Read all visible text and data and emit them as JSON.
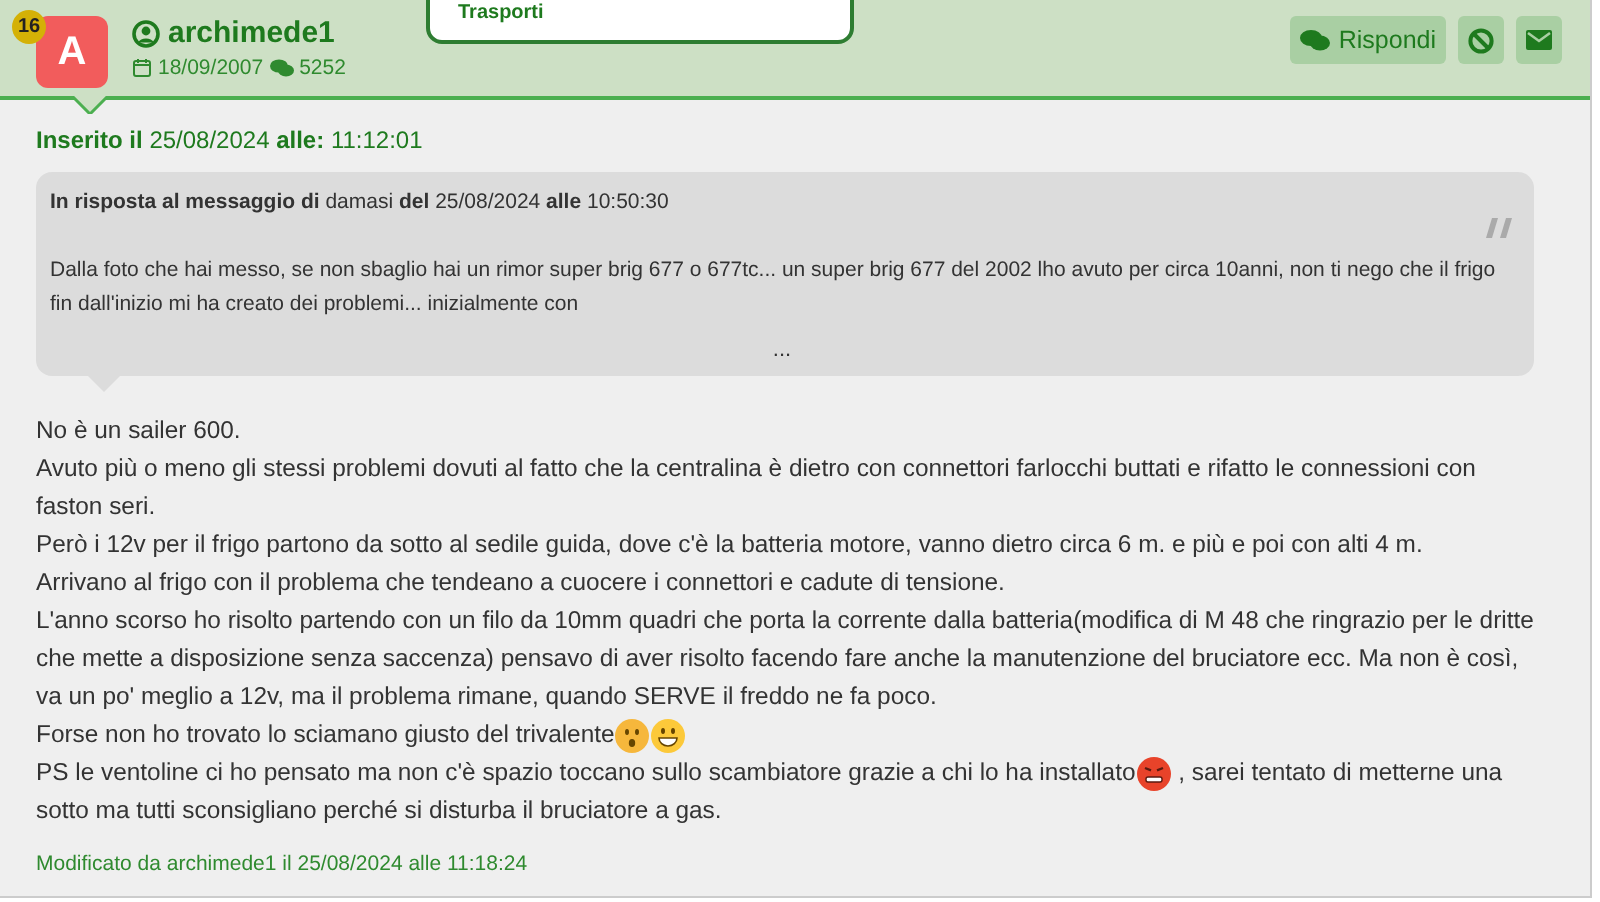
{
  "popup": {
    "text": "Trasporti"
  },
  "author": {
    "badge": "16",
    "initial": "A",
    "name": "archimede1",
    "joined": "18/09/2007",
    "posts": "5252"
  },
  "actions": {
    "reply": "Rispondi"
  },
  "posted": {
    "label": "Inserito il",
    "date": "25/08/2024",
    "at_label": "alle:",
    "time": "11:12:01"
  },
  "quote": {
    "header": "**In risposta al messaggio di** damasi **del** 25/08/2024 **alle** 10:50:30",
    "text": "Dalla foto che hai messo, se non sbaglio hai un rimor super brig 677 o 677tc... un super brig 677 del 2002 lho avuto per circa 10anni, non ti nego che il frigo fin dall'inizio mi ha creato dei problemi... inizialmente con",
    "more": "..."
  },
  "body": [
    [
      {
        "kind": "text",
        "text": "No è un sailer 600."
      }
    ],
    [
      {
        "kind": "text",
        "text": "Avuto più o meno gli stessi problemi dovuti al fatto che la centralina è dietro con connettori farlocchi buttati e rifatto le connessioni con faston seri."
      }
    ],
    [
      {
        "kind": "text",
        "text": "Però i 12v per il frigo partono da sotto al sedile guida, dove c'è la batteria motore, vanno dietro circa 6 m. e più e poi con alti 4 m."
      }
    ],
    [
      {
        "kind": "text",
        "text": "Arrivano al frigo con il problema che tendeano a cuocere i connettori e cadute di tensione."
      }
    ],
    [
      {
        "kind": "text",
        "text": "L'anno scorso ho risolto partendo con un filo da 10mm quadri che porta la corrente dalla batteria(modifica di M 48 che ringrazio per le dritte che mette a disposizione senza saccenza) pensavo di aver risolto facendo fare anche la manutenzione del bruciatore ecc. Ma non è così, va un po' meglio a 12v, ma il problema  rimane, quando SERVE il freddo ne fa poco."
      }
    ],
    [
      {
        "kind": "text",
        "text": "Forse non ho trovato lo sciamano giusto del trivalente"
      },
      {
        "kind": "surprised"
      },
      {
        "kind": "grin"
      }
    ],
    [
      {
        "kind": "text",
        "text": "PS le ventoline ci ho pensato ma non c'è spazio toccano sullo scambiatore grazie a chi lo ha installato"
      },
      {
        "kind": "angry"
      },
      {
        "kind": "text",
        "text": " , sarei tentato di metterne una sotto ma tutti sconsigliano perché si disturba il bruciatore a gas."
      }
    ]
  ],
  "edited": "Modificato da archimede1 il 25/08/2024 alle 11:18:24"
}
